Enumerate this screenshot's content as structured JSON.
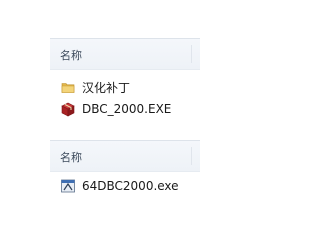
{
  "top_panel": {
    "column_header": "名称",
    "items": [
      {
        "name": "汉化补丁",
        "icon": "folder-icon"
      },
      {
        "name": "DBC_2000.EXE",
        "icon": "installer-box-icon"
      }
    ]
  },
  "bottom_panel": {
    "column_header": "名称",
    "items": [
      {
        "name": "64DBC2000.exe",
        "icon": "application-icon"
      }
    ]
  }
}
